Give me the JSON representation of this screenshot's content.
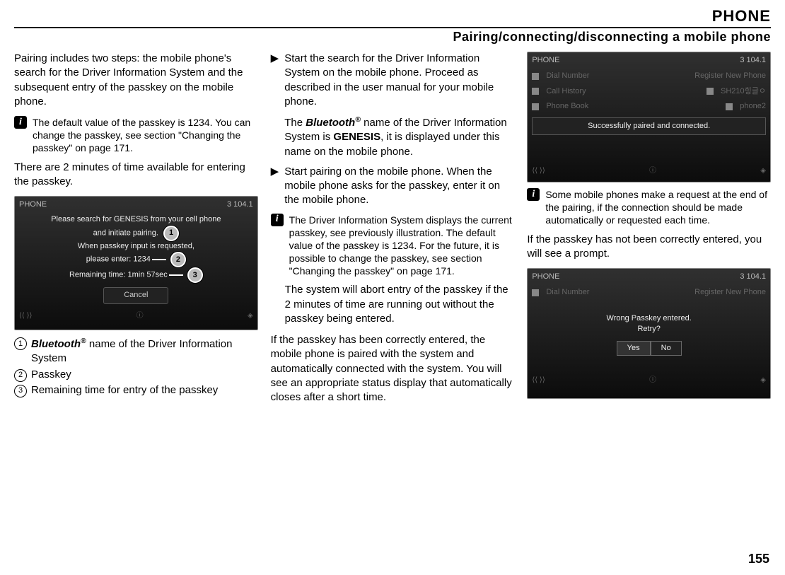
{
  "header": {
    "title": "PHONE",
    "subtitle": "Pairing/connecting/disconnecting a mobile phone"
  },
  "page_number": "155",
  "col1": {
    "intro": "Pairing includes two steps: the mobile phone's search for the Driver Information System and the subsequent entry of the passkey on the mobile phone.",
    "info1": "The default value of the passkey is 1234. You can change the passkey, see section \"Changing the passkey\" on page 171.",
    "after_info": "There are 2 minutes of time available for entering the passkey.",
    "ss1": {
      "head_left": "PHONE",
      "head_right": "3   104.1",
      "l1": "Please search for GENESIS from your cell phone",
      "l2": "and initiate pairing.",
      "l3a": "When passkey input is requested,",
      "l3b": "please enter: 1234",
      "l4": "Remaining time:  1min 57sec",
      "cancel": "Cancel",
      "badge1": "1",
      "badge2": "2",
      "badge3": "3"
    },
    "cap1a": "Bluetooth",
    "cap1b": " name of the Driver Information System",
    "cap2": "Passkey",
    "cap3": "Remaining time for entry of the passkey"
  },
  "col2": {
    "step1a": "Start the search for the Driver Information System on the mobile phone. Proceed as described in the user manual for your mobile phone.",
    "step1b_pre": "The ",
    "step1b_bt": "Bluetooth",
    "step1b_mid": " name of the Driver Information System is ",
    "step1b_gen": "GENESIS",
    "step1b_post": ", it is displayed under this name on the mobile phone.",
    "step2": "Start pairing on the mobile phone. When the mobile phone asks for the passkey, enter it on the mobile phone.",
    "info2": "The Driver Information System displays the current passkey, see previously illustration. The default value of the passkey is 1234. For the future, it is possible to change the passkey, see section \"Changing the passkey\" on page 171.",
    "abort": "The system will abort entry of the passkey if the 2 minutes of time are running out without the passkey being entered.",
    "correct": "If the passkey has been correctly entered, the mobile phone is paired with the system and automatically connected with the system. You will see an appropriate status display that automatically closes after a short time."
  },
  "col3": {
    "ss2": {
      "head_left": "PHONE",
      "head_right": "3   104.1",
      "r1l": "Dial Number",
      "r1r": "Register New Phone",
      "r2l": "Call History",
      "r2r": "SH210힝글ㅇ",
      "r3l": "Phone Book",
      "r3r": "phone2",
      "msg": "Successfully paired and connected."
    },
    "info3": "Some mobile phones make a request at the end of the pairing, if the connection should be made automatically or requested each time.",
    "wrong_intro": "If the passkey has not been correctly entered, you will see a prompt.",
    "ss3": {
      "head_left": "PHONE",
      "head_right": "3   104.1",
      "r1l": "Dial Number",
      "r1r": "Register New Phone",
      "msg1": "Wrong Passkey entered.",
      "msg2": "Retry?",
      "yes": "Yes",
      "no": "No"
    }
  }
}
